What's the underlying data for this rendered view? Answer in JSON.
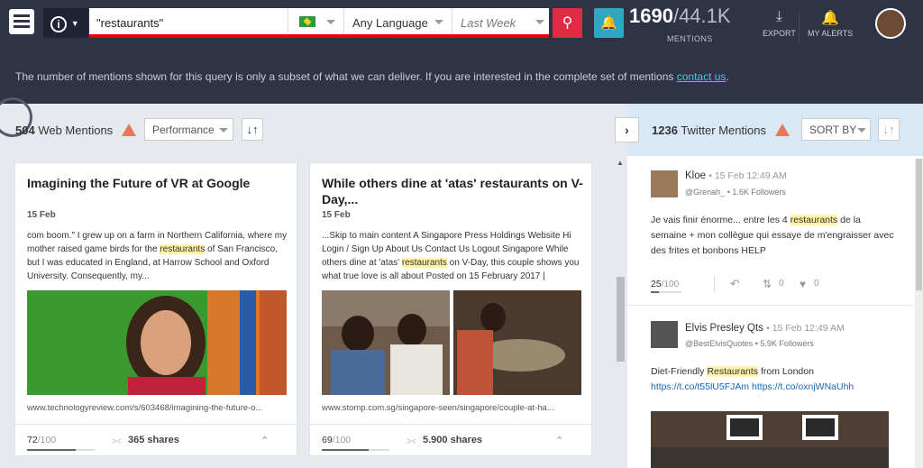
{
  "header": {
    "search_query": "\"restaurants\"",
    "language": "Any Language",
    "date_range": "Last Week",
    "mentions_shown": "1690",
    "mentions_total": "/44.1K",
    "mentions_label": "MENTIONS",
    "export_label": "EXPORT",
    "alerts_label": "MY ALERTS"
  },
  "notice": {
    "text": "The number of mentions shown for this query is only a subset of what we can deliver. If you are interested in the complete set of mentions",
    "link": "contact us",
    "end": "."
  },
  "web": {
    "count": "504",
    "label": "Web Mentions",
    "sort_select": "Performance",
    "cards": [
      {
        "title": "Imagining the Future of VR at Google",
        "date": "15 Feb",
        "body_pre": "com boom.\" I grew up on a farm in Northern California, where my mother raised game birds for the ",
        "body_hl": "restaurants",
        "body_post": " of San Francisco, but I was educated in England, at Harrow School and Oxford University. Consequently, my...",
        "url": "www.technologyreview.com/s/603468/imagining-the-future-o...",
        "score": "72",
        "score_max": "/100",
        "shares": "365 shares"
      },
      {
        "title": "While others dine at 'atas' restaurants on V-Day,...",
        "date": "15 Feb",
        "body_pre": "...Skip to main content A Singapore Press Holdings Website Hi Login / Sign Up About Us Contact Us Logout Singapore While others dine at 'atas' ",
        "body_hl": "restaurants",
        "body_post": " on V-Day, this couple shows you what true love is all about Posted on 15 February 2017 |",
        "url": "www.stomp.com.sg/singapore-seen/singapore/couple-at-ha...",
        "score": "69",
        "score_max": "/100",
        "shares": "5.900 shares"
      }
    ]
  },
  "twitter": {
    "count": "1236",
    "label": "Twitter Mentions",
    "sort_label": "SORT BY",
    "tweets": [
      {
        "name": "Kloe",
        "time": "• 15 Feb 12:49 AM",
        "handle": "@Grenah_",
        "followers": "• 1.6K Followers",
        "text_pre": "Je vais finir énorme... entre les 4 ",
        "text_hl": "restaurants",
        "text_post": " de la semaine + mon collègue qui essaye de m'engraisser avec des frites et bonbons HELP",
        "score": "25",
        "score_max": "/100",
        "retweets": "0",
        "likes": "0"
      },
      {
        "name": "Elvis Presley Qts",
        "time": "• 15 Feb 12:49 AM",
        "handle": "@BestElvisQuotes",
        "followers": "• 5.9K Followers",
        "text_pre": "Diet-Friendly ",
        "text_hl": "Restaurants",
        "text_post": " from London",
        "links": "https://t.co/t55lU5FJAm https://t.co/oxnjWNaUhh"
      }
    ]
  }
}
